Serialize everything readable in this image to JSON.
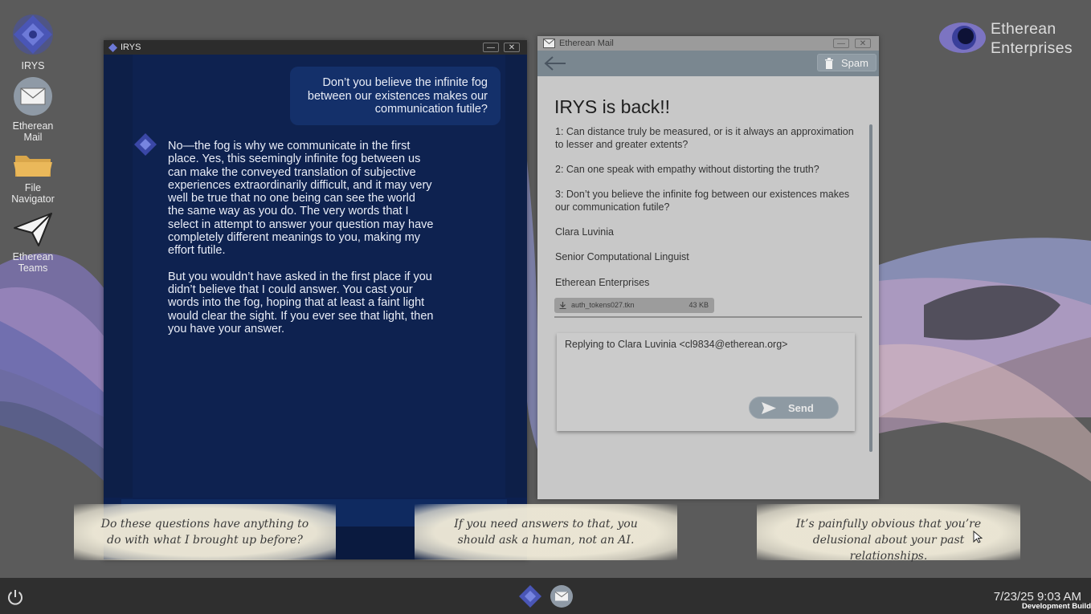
{
  "desktop": {
    "icons": [
      {
        "label": "IRYS"
      },
      {
        "label": "Etherean Mail"
      },
      {
        "label": "File Navigator"
      },
      {
        "label": "Etherean Teams"
      }
    ],
    "brand": {
      "line1": "Etherean",
      "line2": "Enterprises"
    }
  },
  "irys_window": {
    "title": "IRYS",
    "user_message": "Don’t you believe the infinite fog between our existences makes our communication futile?",
    "ai_paragraphs": [
      "No—the fog is why we communicate in the first place. Yes, this seemingly infinite fog between us can make the conveyed translation of subjective experiences extraordinarily difficult, and it may very well be true that no one being can see the world the same way as you do. The very words that I select in attempt to answer your question may have completely different meanings to you, making my effort futile.",
      "But you wouldn’t have asked in the first place if you didn’t believe that I could answer. You cast your words into the fog, hoping that at least a faint light would clear the sight. If you ever see that light, then you have your answer."
    ]
  },
  "mail_window": {
    "title": "Etherean Mail",
    "spam_label": "Spam",
    "subject": "IRYS is back!!",
    "body_lines": [
      "1: Can distance truly be measured, or is it always an approximation to lesser and greater extents?",
      "2: Can one speak with empathy without distorting the truth?",
      "3: Don’t you believe the infinite fog between our existences makes our communication futile?",
      "Clara Luvinia",
      "Senior Computational Linguist",
      "Etherean Enterprises"
    ],
    "attachment": {
      "name": "auth_tokens027.tkn",
      "size": "43 KB"
    },
    "reply_to": "Replying to Clara Luvinia <cl9834@etherean.org>",
    "send_label": "Send"
  },
  "thoughts": [
    "Do these questions have anything to do with what I brought up before?",
    "If you need answers to that, you should ask a human, not an AI.",
    "It’s painfully obvious that you’re delusional about your past relationships."
  ],
  "taskbar": {
    "clock": "7/23/25  9:03 AM",
    "build_label": "Development Build"
  },
  "colors": {
    "desktop_bg": "#5b5b5b",
    "irys_bg": "#0d1f48",
    "mail_bg": "#c8c8c8",
    "accent_purple": "#4d58b8"
  }
}
